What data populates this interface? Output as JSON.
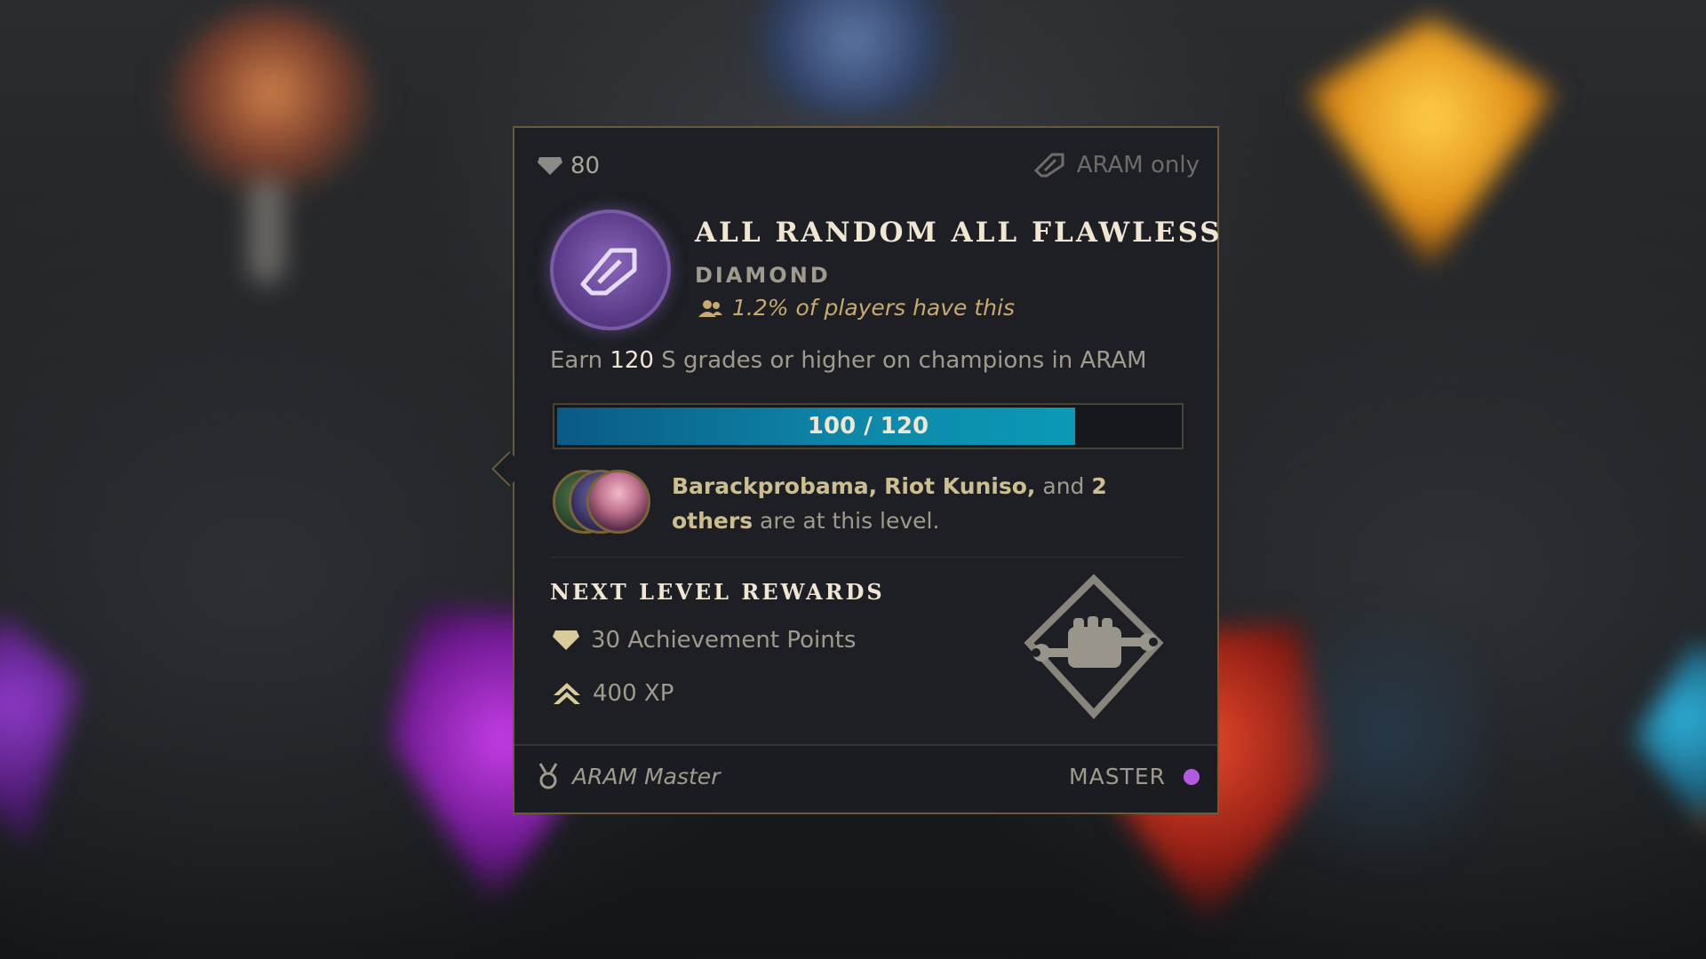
{
  "header": {
    "points": "80",
    "restriction": "ARAM only"
  },
  "challenge": {
    "title": "ALL RANDOM ALL FLAWLESS",
    "tier": "DIAMOND",
    "rarity": "1.2% of players have this",
    "description_prefix": "Earn ",
    "description_count": "120",
    "description_suffix": " S grades or higher on champions in ARAM"
  },
  "progress": {
    "current": 100,
    "target": 120,
    "label": "100 / 120"
  },
  "friends": {
    "name1": "Barackprobama,",
    "name2": "Riot Kuniso,",
    "and_word": "and",
    "count": "2",
    "others_word": "others",
    "suffix": "are at this level."
  },
  "rewards": {
    "heading": "NEXT LEVEL REWARDS",
    "items": [
      {
        "label": "30 Achievement Points",
        "icon": "gem-icon"
      },
      {
        "label": "400 XP",
        "icon": "xp-chevron-icon"
      }
    ]
  },
  "footer": {
    "title": "ARAM Master",
    "rank": "MASTER",
    "rank_color": "#b35be0"
  }
}
